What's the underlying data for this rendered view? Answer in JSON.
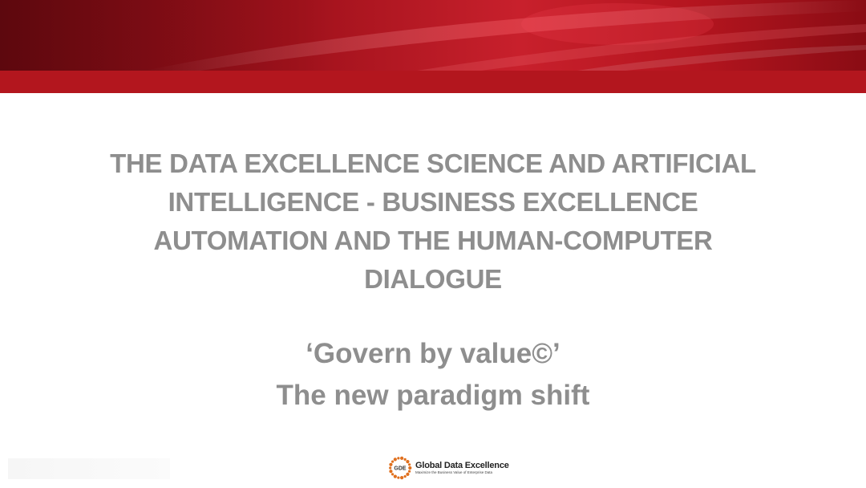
{
  "slide": {
    "title": "THE DATA EXCELLENCE SCIENCE AND ARTIFICIAL INTELLIGENCE - BUSINESS EXCELLENCE AUTOMATION AND THE HUMAN-COMPUTER DIALOGUE",
    "subtitle_line1": "‘Govern by value©’",
    "subtitle_line2": "The new paradigm shift"
  },
  "logo": {
    "monogram": "GDE",
    "name": "Global Data Excellence",
    "tagline": "Maximize the Business Value of Enterprise Data"
  },
  "colors": {
    "banner_dark": "#7c0a12",
    "banner_red": "#c8202c",
    "stripe": "#b3161e",
    "text_gray": "#8e8e8e",
    "logo_orange": "#e0701e"
  },
  "icons": {
    "logo_mark": "gde-circle-logo-icon"
  }
}
